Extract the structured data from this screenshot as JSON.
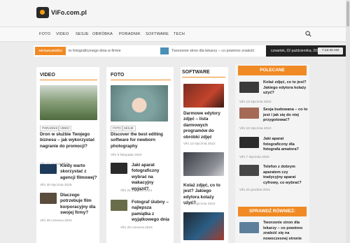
{
  "header": {
    "logo_text": "ViFo.com.pl"
  },
  "nav": {
    "items": [
      "FOTO",
      "VIDEO",
      "SESJE",
      "OBRÓBKA",
      "PORADNIK",
      "SOFTWARE",
      "TECH"
    ]
  },
  "ticker": {
    "label": "AKTUALNOŚCI",
    "text1": "to fotograficznego dnia w firmie",
    "text2": "Tworzenie stron dla lekarzy – co powinno znaleźć się na nowoczesnej stronie",
    "date": "czwartek, 02 października, 2025",
    "time": "7:12:40 AM"
  },
  "video_col": {
    "title": "VIDEO",
    "featured": {
      "cats": [
        "PORADNIK",
        "VIDEO"
      ],
      "title": "Dron w służbie Twojego biznesu – jak wykorzystać nagranie do promocji?",
      "meta": "Vifo 21 marca 2025"
    },
    "items": [
      {
        "title": "Kiedy warto skorzystać z agencji filmowej?",
        "meta": "Vifo 30 stycznia 2025"
      },
      {
        "title": "Dlaczego potrzebuje film korporacyjny dla swojej firmy?",
        "meta": "Vifo 29 czerwca 2024"
      }
    ]
  },
  "foto_col": {
    "title": "FOTO",
    "featured": {
      "cats": [
        "FOTO",
        "SESJE"
      ],
      "title": "Discover the best editing software for newborn photography",
      "meta": "Vifo 5 listopada 2024"
    },
    "items": [
      {
        "title": "Jaki aparat fotograficzny wybrać na wakacyjny wyjazd?",
        "meta": "Vifo 21 sierpnia 2024"
      },
      {
        "title": "Fotograf ślubny – najlepsza pamiątka z wyjątkowego dnia",
        "meta": "Vifo 29 czerwca 2024"
      }
    ]
  },
  "software_col": {
    "title": "SOFTWARE",
    "items": [
      {
        "title": "Darmowe edytory zdjęć – lista darmowych programów do obróbki zdjęć",
        "meta": "Vifo 13 stycznia 2022"
      },
      {
        "title": "Kolaż zdjęć, co to jest? Jakiego edytora kolaży użyć?",
        "meta": "Vifo 13 stycznia 2022"
      }
    ]
  },
  "sidebar": {
    "popular_title": "POLECANE",
    "popular": [
      {
        "title": "Kolaż zdjęć, co to jest? Jakiego edytora kolaży użyć?",
        "meta": "Vifo 13 stycznia 2022"
      },
      {
        "title": "Sesja budowana – co to jest i jak się do niej przygotować?",
        "meta": "Vifo 10 stycznia 2022"
      },
      {
        "title": "Jaki aparat fotograficzny dla fotografa amatora?",
        "meta": "Vifo 7 stycznia 2022"
      },
      {
        "title": "Telefon z dobrym aparatem czy tradycyjny aparat cyfrowy, co wybrać?",
        "meta": "Vifo 24 grudnia 2021"
      }
    ],
    "check_title": "SPRAWDŹ RÓWNIEŻ:",
    "check": [
      {
        "title": "Tworzenie stron dla lekarzy – co powinno znaleźć się na nowoczesnej stronie"
      }
    ]
  },
  "colors": {
    "accent": "#f08a24",
    "dark": "#222222",
    "background": "#ececec"
  },
  "icons": {
    "search": "search-icon",
    "logo": "camera-logo-icon"
  }
}
